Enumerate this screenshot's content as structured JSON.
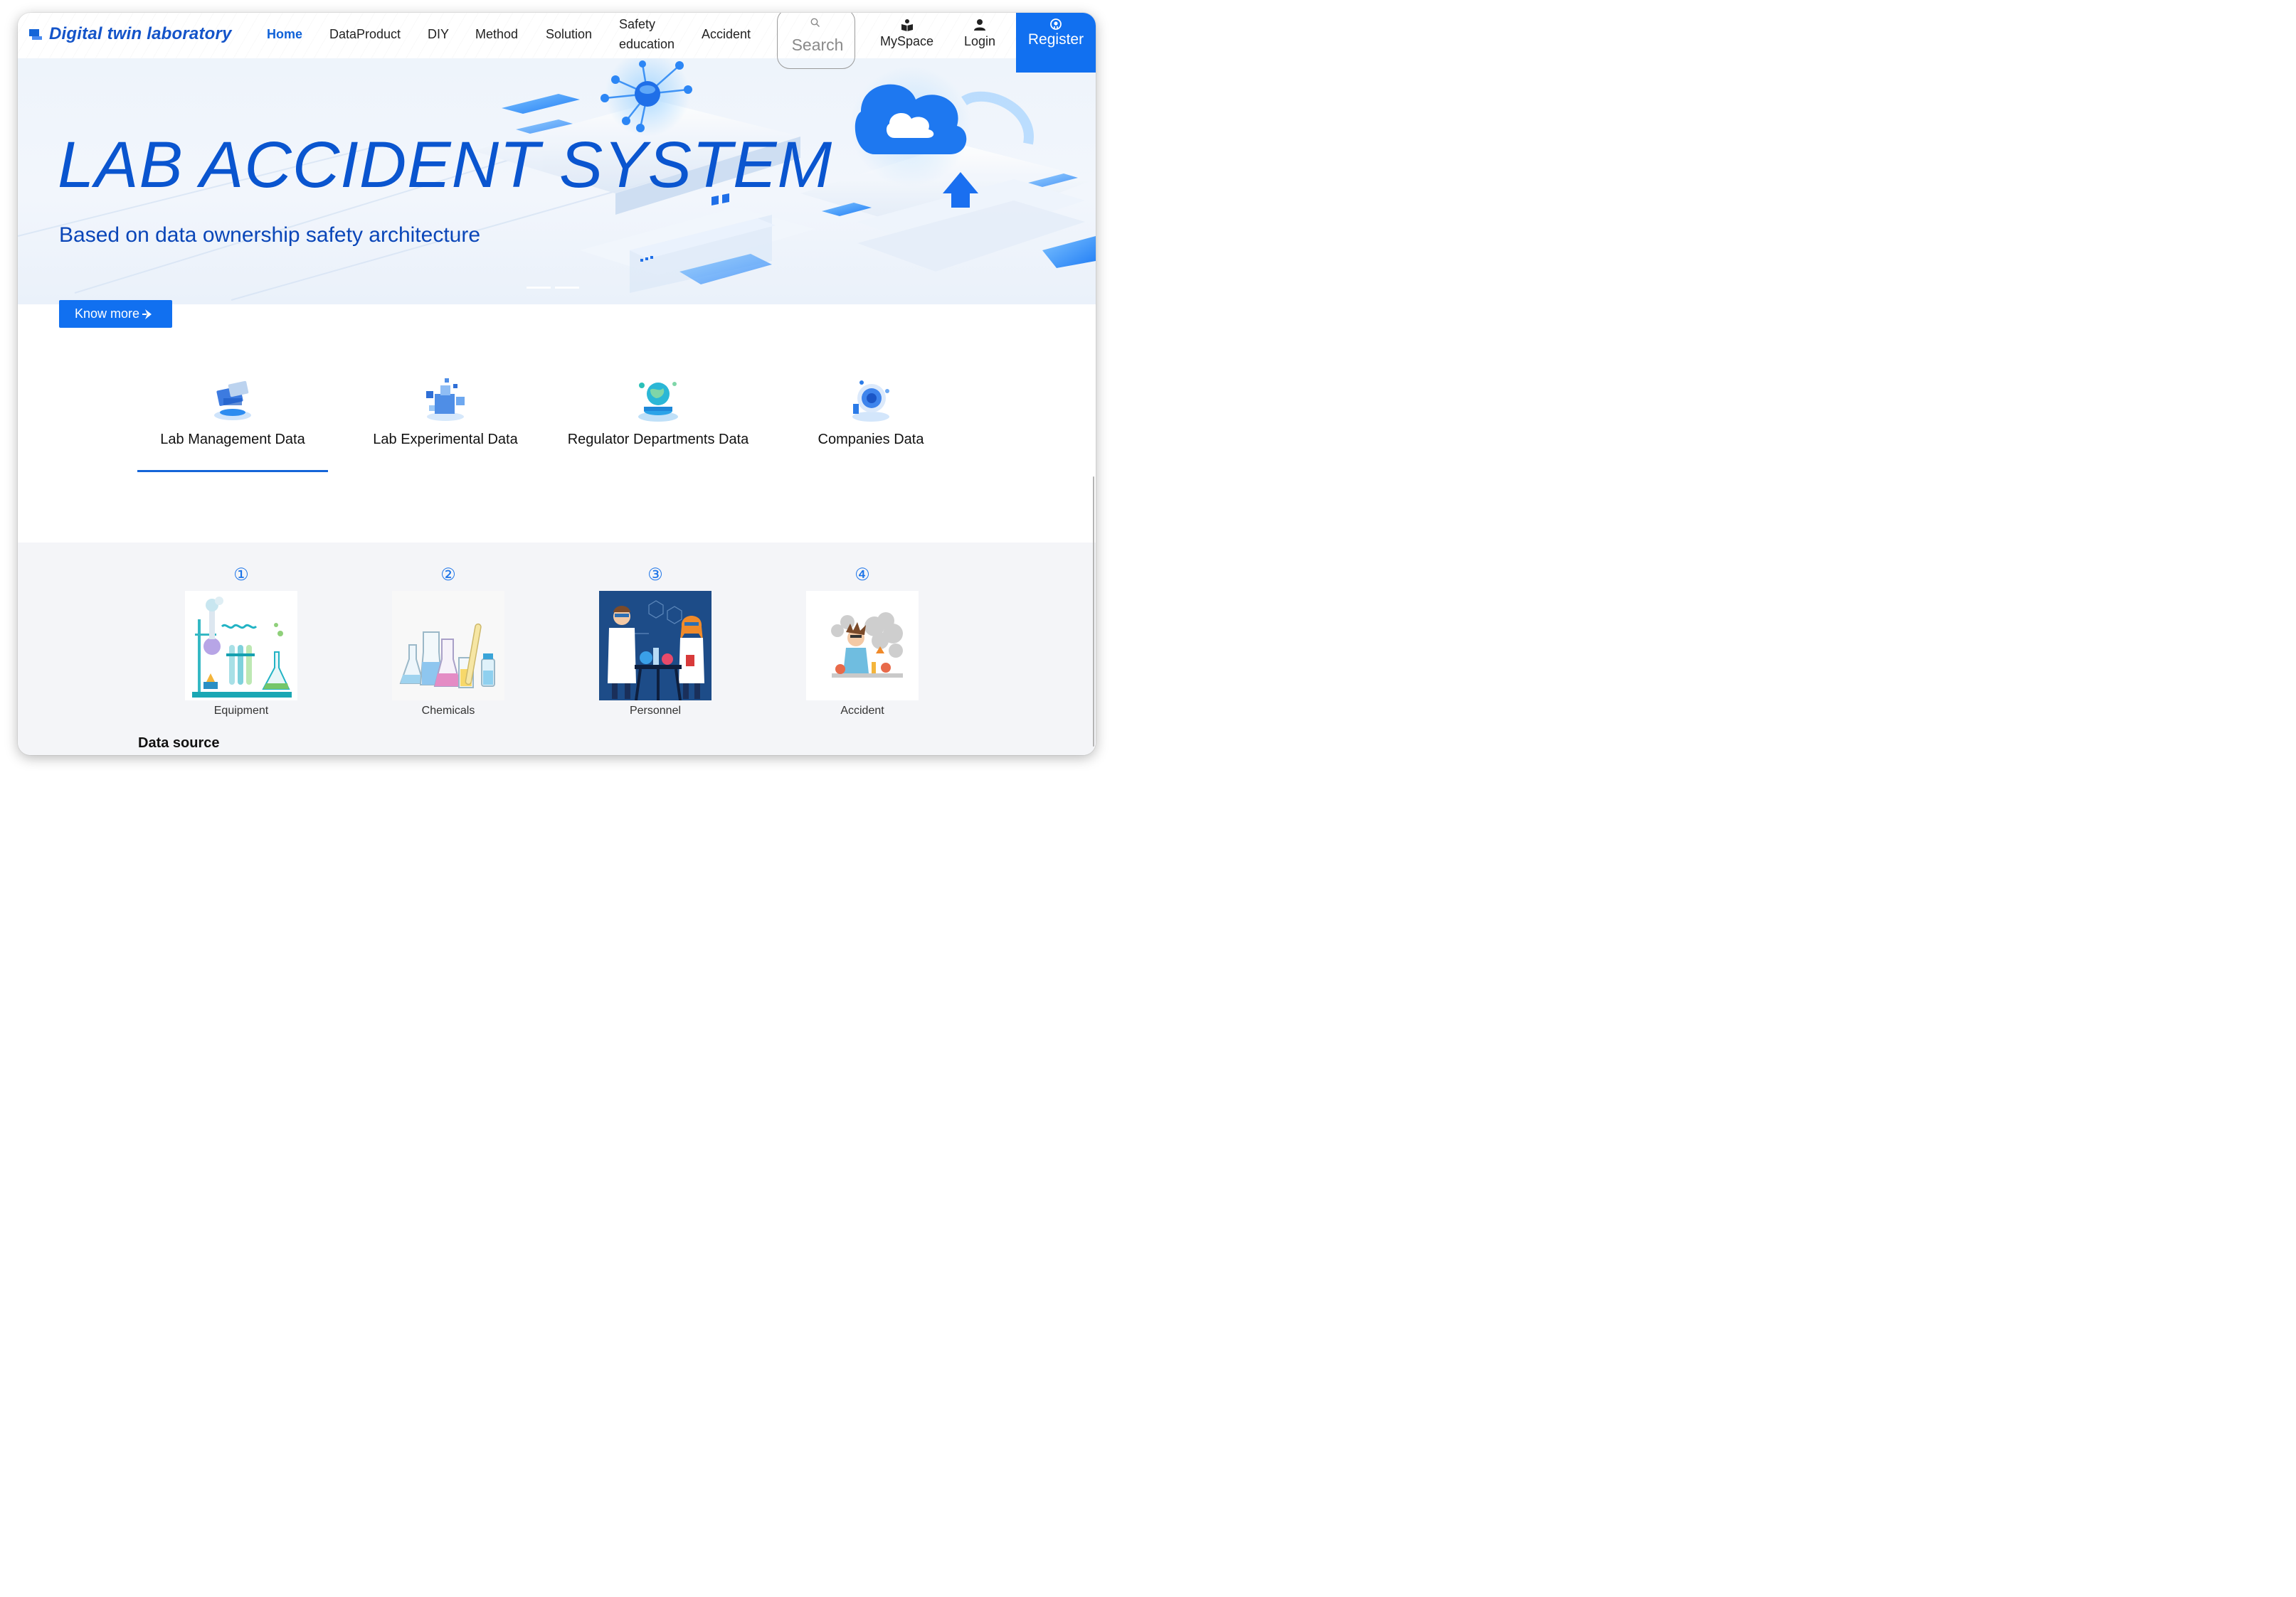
{
  "brand": {
    "title": "Digital twin laboratory"
  },
  "nav": {
    "items": [
      {
        "label": "Home",
        "active": true
      },
      {
        "label": "DataProduct"
      },
      {
        "label": "DIY"
      },
      {
        "label": "Method"
      },
      {
        "label": "Solution"
      },
      {
        "label_line1": "Safety",
        "label_line2": "education"
      },
      {
        "label": "Accident"
      }
    ],
    "search_placeholder": "Search",
    "myspace": "MySpace",
    "login": "Login",
    "register": "Register"
  },
  "hero": {
    "title": "LAB ACCIDENT SYSTEM",
    "subtitle": "Based on data ownership safety architecture",
    "button": "Know more"
  },
  "categories": [
    {
      "label": "Lab Management Data",
      "selected": true
    },
    {
      "label": "Lab Experimental Data"
    },
    {
      "label": "Regulator Departments Data"
    },
    {
      "label": "Companies Data"
    }
  ],
  "data_source": {
    "title": "Data source",
    "cards": [
      {
        "num": "①",
        "caption": "Equipment"
      },
      {
        "num": "②",
        "caption": "Chemicals"
      },
      {
        "num": "③",
        "caption": "Personnel"
      },
      {
        "num": "④",
        "caption": "Accident"
      }
    ]
  },
  "colors": {
    "accent": "#1170f0",
    "brand": "#1454c9",
    "hero_text": "#0a55cf",
    "section_bg": "#f4f5f8"
  }
}
